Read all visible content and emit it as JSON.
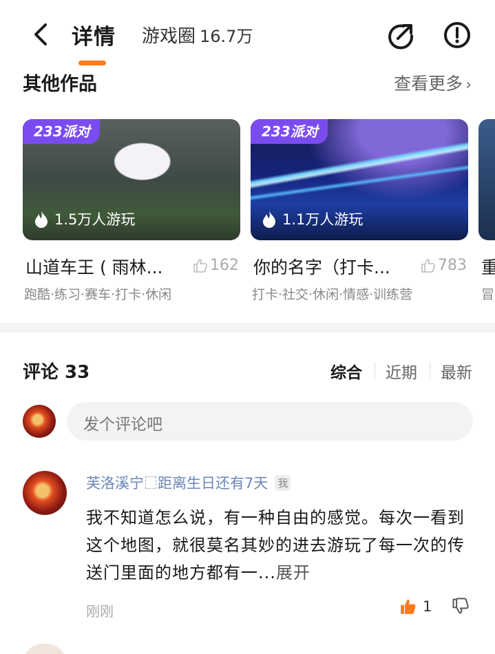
{
  "header": {
    "tab_detail": "详情",
    "circle_label": "游戏圈",
    "circle_count": "16.7万"
  },
  "other_works": {
    "title": "其他作品",
    "more_label": "查看更多",
    "cards": [
      {
        "badge": "233派对",
        "plays": "1.5万人游玩",
        "title": "山道车王 ( 雨林...",
        "likes": "162",
        "tags": "跑酷·练习·赛车·打卡·休闲"
      },
      {
        "badge": "233派对",
        "plays": "1.1万人游玩",
        "title": "你的名字（打卡...",
        "likes": "783",
        "tags": "打卡·社交·休闲·情感·训练营"
      },
      {
        "title": "重",
        "tags": "冒"
      }
    ]
  },
  "comments": {
    "title": "评论 33",
    "sort_options": [
      "综合",
      "近期",
      "最新"
    ],
    "active_sort": "综合",
    "input_placeholder": "发个评论吧",
    "items": [
      {
        "user_prefix": "芙洛溪宁",
        "user_suffix": "距离生日还有7天",
        "tag": "我",
        "body": "我不知道怎么说，有一种自由的感觉。每次一看到这个地图，就很莫名其妙的进去游玩了每一次的传送门里面的地方都有一...",
        "expand_label": "展开",
        "time": "刚刚",
        "likes": "1"
      }
    ]
  },
  "colors": {
    "accent": "#ff7a1a",
    "badge": "#7a4cf0",
    "username": "#6b86b7"
  }
}
